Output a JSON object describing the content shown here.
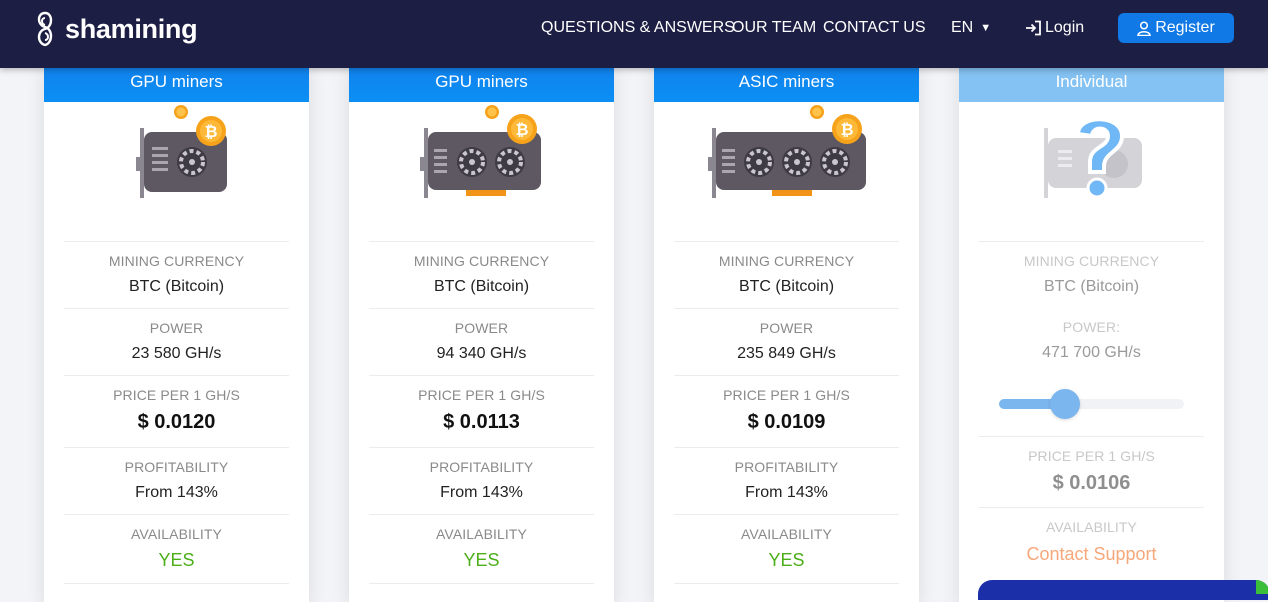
{
  "navbar": {
    "logo_text": "shamining",
    "links": [
      "QUESTIONS & ANSWERS",
      "OUR TEAM",
      "CONTACT US"
    ],
    "language": "EN",
    "login": "Login",
    "register": "Register"
  },
  "cards": [
    {
      "title": "GPU miners",
      "currency_label": "MINING CURRENCY",
      "currency": "BTC (Bitcoin)",
      "power_label": "POWER",
      "power": "23 580 GH/s",
      "price_label": "PRICE PER 1 GH/S",
      "price": "$ 0.0120",
      "profit_label": "PROFITABILITY",
      "profit": "From 143%",
      "avail_label": "AVAILABILITY",
      "availability": "YES"
    },
    {
      "title": "GPU miners",
      "currency_label": "MINING CURRENCY",
      "currency": "BTC (Bitcoin)",
      "power_label": "POWER",
      "power": "94 340 GH/s",
      "price_label": "PRICE PER 1 GH/S",
      "price": "$ 0.0113",
      "profit_label": "PROFITABILITY",
      "profit": "From 143%",
      "avail_label": "AVAILABILITY",
      "availability": "YES"
    },
    {
      "title": "ASIC miners",
      "currency_label": "MINING CURRENCY",
      "currency": "BTC (Bitcoin)",
      "power_label": "POWER",
      "power": "235 849 GH/s",
      "price_label": "PRICE PER 1 GH/S",
      "price": "$ 0.0109",
      "profit_label": "PROFITABILITY",
      "profit": "From 143%",
      "avail_label": "AVAILABILITY",
      "availability": "YES"
    },
    {
      "title": "Individual",
      "currency_label": "MINING CURRENCY",
      "currency": "BTC (Bitcoin)",
      "power_label": "POWER:",
      "power": "471 700 GH/s",
      "slider_level": 0.3,
      "price_label": "PRICE PER 1 GH/S",
      "price": "$ 0.0106",
      "avail_label": "AVAILABILITY",
      "availability": "Contact Support"
    }
  ],
  "colors": {
    "navbar": "#1d1e43",
    "primary": "#1079e6",
    "card_header": "#0b8ff4",
    "available": "#4caf1a",
    "support": "#f7a77a"
  }
}
